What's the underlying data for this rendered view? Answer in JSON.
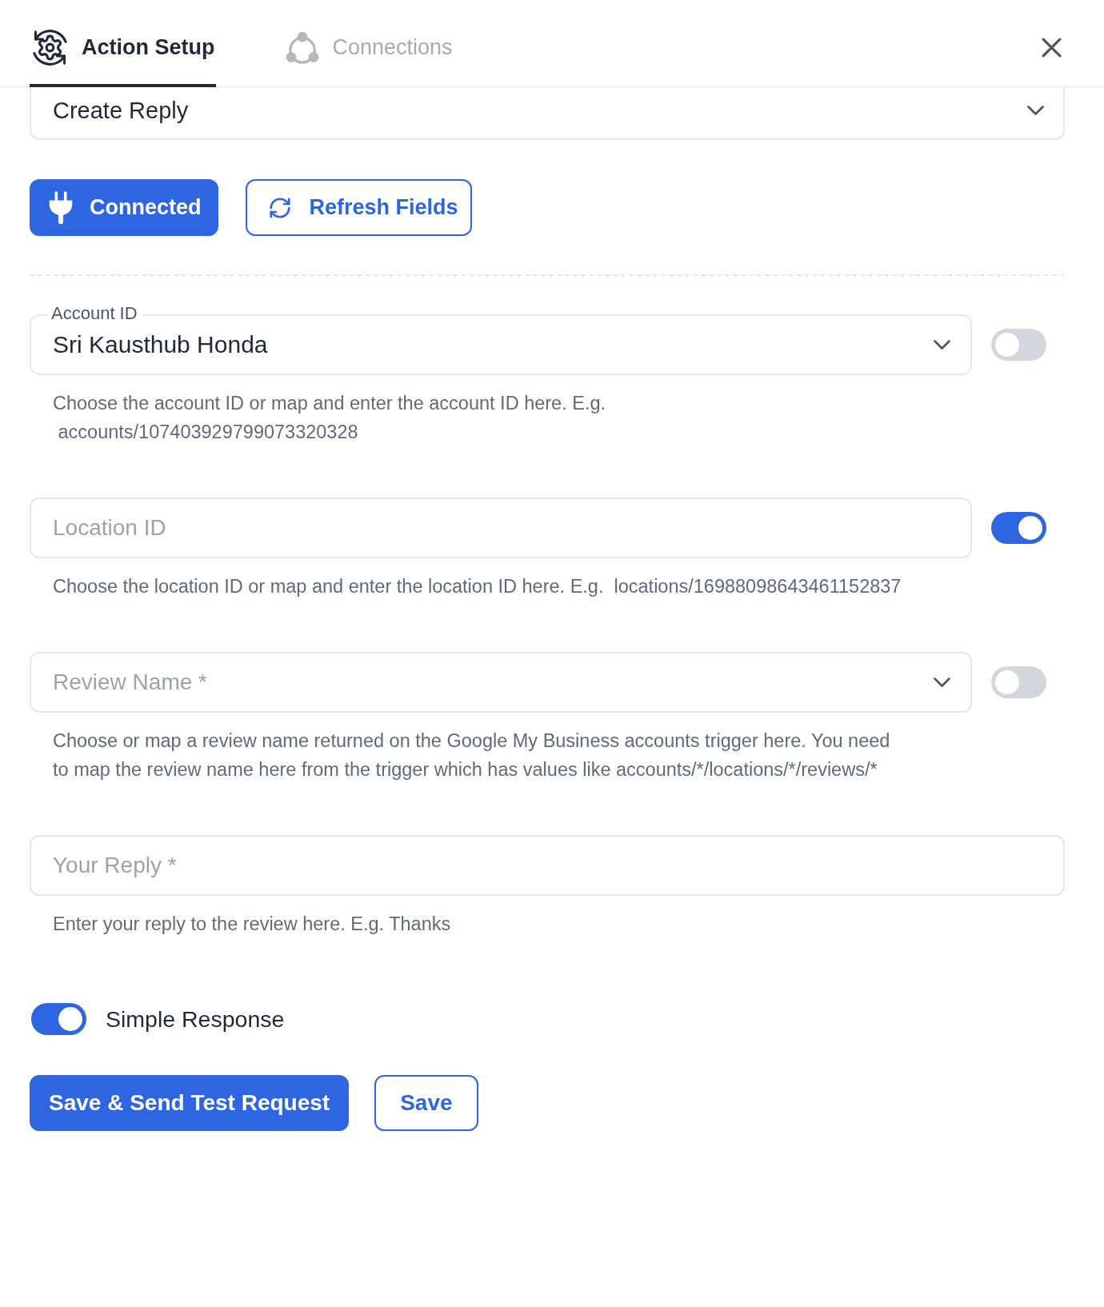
{
  "tabs": [
    {
      "label": "Action Setup",
      "selected": true
    },
    {
      "label": "Connections",
      "selected": false
    }
  ],
  "action_select": {
    "value": "Create Reply"
  },
  "connection_buttons": [
    {
      "label": "Connected",
      "kind": "primary"
    },
    {
      "label": "Refresh Fields",
      "kind": "outline"
    }
  ],
  "fields": [
    {
      "kind": "select",
      "label": "Account ID",
      "value": "Sri Kausthub Honda",
      "map_toggle": {
        "on": false
      },
      "help": "Choose the account ID or map and enter the account ID here. E.g.\n accounts/107403929799073320328"
    },
    {
      "kind": "text",
      "placeholder": "Location ID",
      "map_toggle": {
        "on": true
      },
      "help": "Choose the location ID or map and enter the location ID here. E.g.  locations/16988098643461152837"
    },
    {
      "kind": "select",
      "placeholder": "Review Name *",
      "map_toggle": {
        "on": false
      },
      "help": "Choose or map a review name returned on the Google My Business accounts trigger here. You need\nto map the review name here from the trigger which has values like accounts/*/locations/*/reviews/*"
    },
    {
      "kind": "text",
      "placeholder": "Your Reply *",
      "help": "Enter your reply to the review here. E.g. Thanks"
    }
  ],
  "simple_response": {
    "label": "Simple Response",
    "on": true
  },
  "footer_buttons": [
    {
      "label": "Save & Send Test Request",
      "kind": "primary"
    },
    {
      "label": "Save",
      "kind": "outline"
    }
  ]
}
